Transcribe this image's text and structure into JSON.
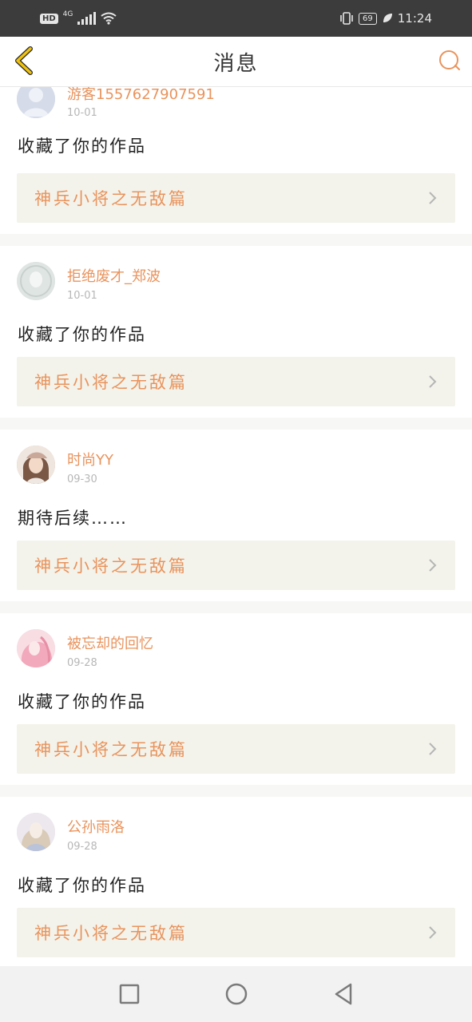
{
  "status_bar": {
    "hd": "HD",
    "network": "4G",
    "battery": "69",
    "time": "11:24"
  },
  "header": {
    "title": "消息",
    "back_icon": "chevron-left-icon",
    "chat_icon": "chat-bubble-icon"
  },
  "colors": {
    "accent": "#e9935c",
    "work_bg": "#f3f3eb",
    "back_icon": "#f0c20f",
    "divider": "#f7f7f5"
  },
  "messages": [
    {
      "user": "游客1557627907591",
      "date": "10-01",
      "text": "收藏了你的作品",
      "work": "神兵小将之无敌篇",
      "avatar": "default-avatar-icon"
    },
    {
      "user": "拒绝废才_郑波",
      "date": "10-01",
      "text": "收藏了你的作品",
      "work": "神兵小将之无敌篇",
      "avatar": "user-avatar"
    },
    {
      "user": "时尚YY",
      "date": "09-30",
      "text": "期待后续……",
      "work": "神兵小将之无敌篇",
      "avatar": "user-avatar"
    },
    {
      "user": "被忘却的回忆",
      "date": "09-28",
      "text": "收藏了你的作品",
      "work": "神兵小将之无敌篇",
      "avatar": "user-avatar"
    },
    {
      "user": "公孙雨洛",
      "date": "09-28",
      "text": "收藏了你的作品",
      "work": "神兵小将之无敌篇",
      "avatar": "user-avatar"
    }
  ],
  "nav_bar": {
    "recents_icon": "square-icon",
    "home_icon": "circle-icon",
    "back_icon": "triangle-back-icon"
  }
}
